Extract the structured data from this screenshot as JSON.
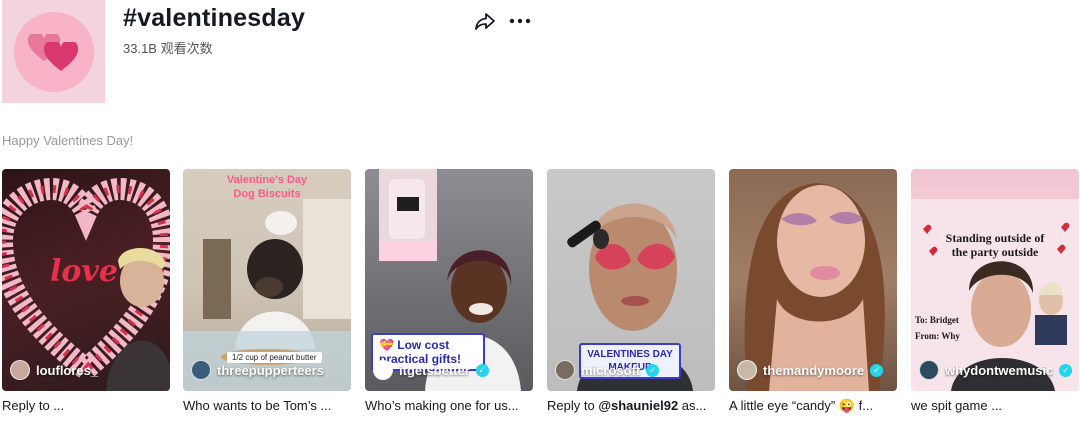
{
  "tag": {
    "title": "#valentinesday",
    "views": "33.1B 观看次数",
    "description": "Happy Valentines Day!"
  },
  "actions": {
    "share_icon": "share-arrow-icon",
    "more_icon": "more-dots-icon"
  },
  "colors": {
    "verified": "#20d5ec",
    "cover_bg": "#f4d4dc",
    "heart_light": "#e8799a",
    "heart_dark": "#d9386f"
  },
  "videos": [
    {
      "username": "louflores_",
      "verified": false,
      "caption": "Reply to ...",
      "mention": ""
    },
    {
      "username": "threepupperteers",
      "verified": false,
      "caption": "Who wants to be Tom’s ...",
      "mention": "",
      "overlay_title": "Valentine's Day\nDog Biscuits",
      "overlay_note": "1/2 cup of peanut butter"
    },
    {
      "username": "itgetsbetter",
      "verified": true,
      "caption": "Who’s making one for us...",
      "mention": "",
      "sticker": "💝 Low cost\npractical gifts!"
    },
    {
      "username": "microsoft",
      "verified": true,
      "caption_pre": "Reply to ",
      "mention": "@shauniel92",
      "caption_post": " as...",
      "sticker": "VALENTINES DAY\nMAKEUP"
    },
    {
      "username": "themandymoore",
      "verified": true,
      "caption": "A little eye “candy” 😜 f...",
      "mention": ""
    },
    {
      "username": "whydontwemusic",
      "verified": true,
      "caption": "we spit game ...",
      "mention": "",
      "paper_text": "Standing outside of\nthe party outside",
      "paper_to": "To: Bridget",
      "paper_from": "From: Why"
    }
  ]
}
